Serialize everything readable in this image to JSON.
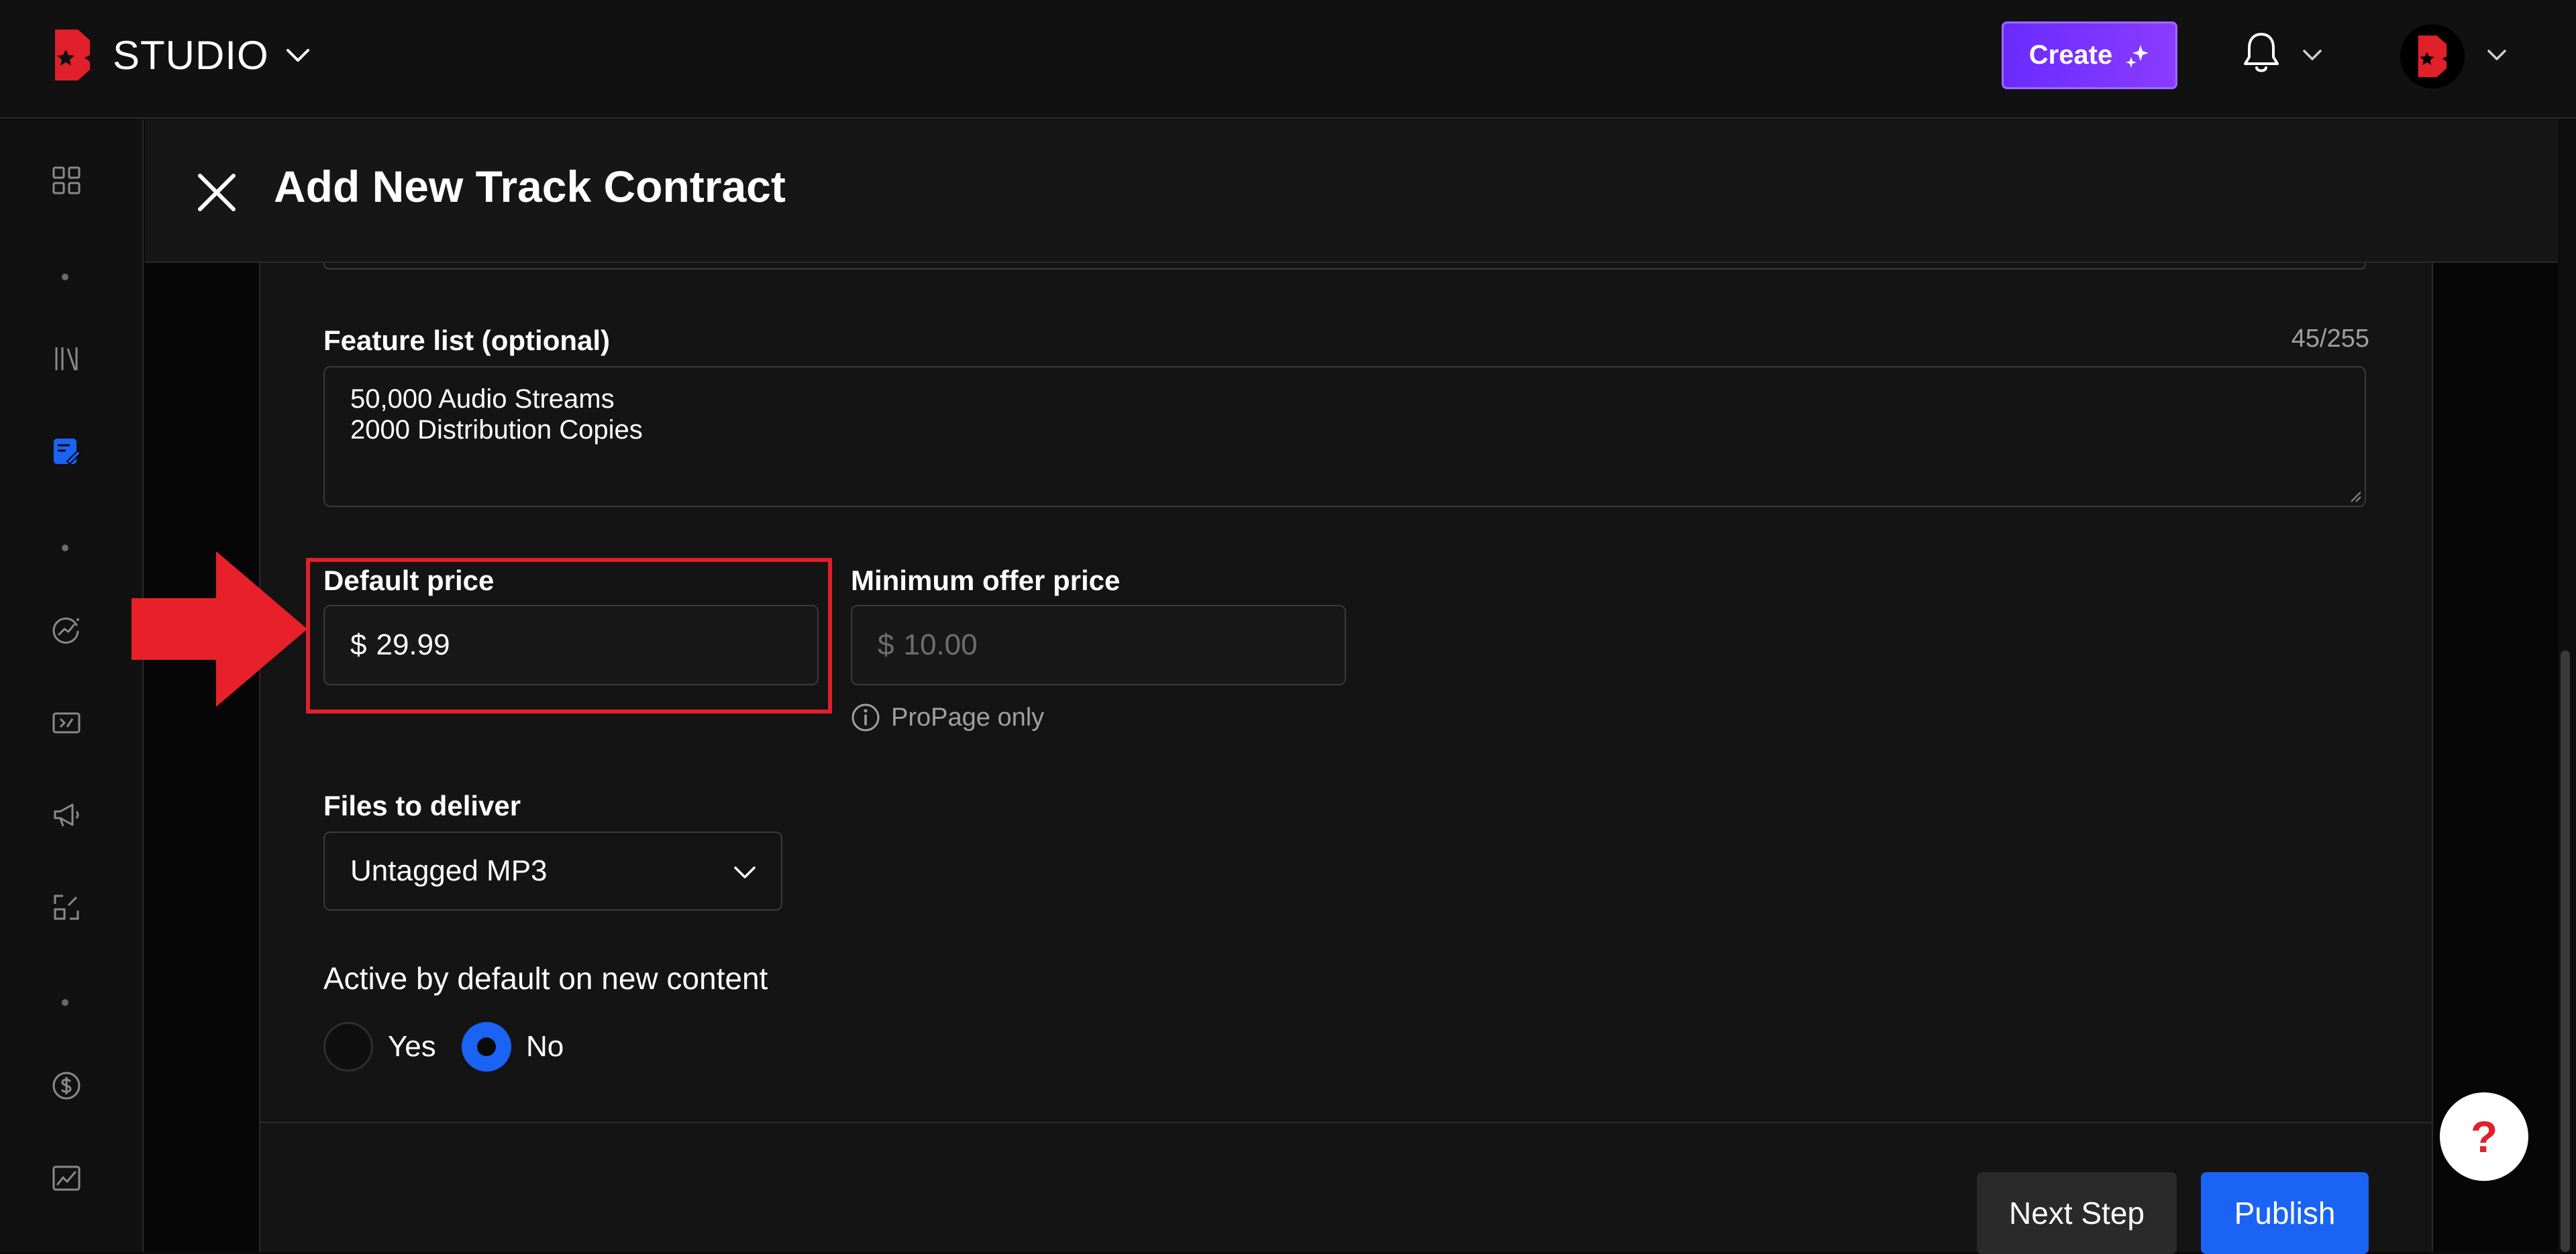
{
  "app": {
    "brand": "STUDIO",
    "create_label": "Create"
  },
  "modal": {
    "title": "Add New Track Contract"
  },
  "feature_list": {
    "label": "Feature list (optional)",
    "counter": "45/255",
    "lines": [
      "50,000 Audio Streams",
      "2000 Distribution Copies"
    ]
  },
  "default_price": {
    "label": "Default price",
    "currency": "$",
    "value": "29.99"
  },
  "minimum_offer": {
    "label": "Minimum offer price",
    "currency": "$",
    "placeholder": "10.00",
    "note": "ProPage only"
  },
  "files": {
    "label": "Files to deliver",
    "selected": "Untagged MP3"
  },
  "active_default": {
    "label": "Active by default on new content",
    "options": [
      "Yes",
      "No"
    ],
    "selected": "No"
  },
  "footer": {
    "next_label": "Next Step",
    "publish_label": "Publish"
  },
  "help": {
    "glyph": "?"
  },
  "colors": {
    "accent_blue": "#1a63f5",
    "create_purple": "#7b33ff",
    "brand_red": "#e0202a"
  },
  "sidebar_icons": [
    "dashboard-icon",
    "library-icon",
    "contracts-icon",
    "analytics-icon",
    "coupons-icon",
    "promote-icon",
    "expand-icon",
    "sales-icon",
    "chart-icon"
  ]
}
